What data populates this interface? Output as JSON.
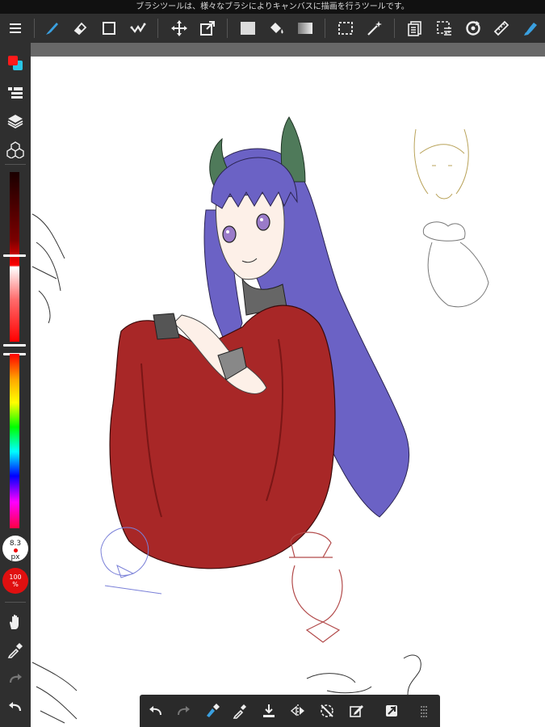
{
  "status_bar": {
    "hint": "ブラシツールは、様々なブラシによりキャンバスに描画を行うツールです。"
  },
  "toolbar": {
    "tools": [
      {
        "name": "menu-icon"
      },
      {
        "name": "brush-icon",
        "active": true
      },
      {
        "name": "eraser-icon"
      },
      {
        "name": "shape-icon"
      },
      {
        "name": "select-pen-icon"
      },
      {
        "name": "move-icon"
      },
      {
        "name": "transform-icon"
      },
      {
        "name": "fill-color-icon"
      },
      {
        "name": "bucket-icon"
      },
      {
        "name": "gradient-icon"
      },
      {
        "name": "select-rect-icon"
      },
      {
        "name": "magic-wand-icon"
      },
      {
        "name": "layer-list-icon"
      },
      {
        "name": "select-layer-icon"
      },
      {
        "name": "rotate-icon"
      },
      {
        "name": "ruler-icon"
      },
      {
        "name": "brush-cursor-icon"
      }
    ]
  },
  "sidebar": {
    "size_label": "8.3",
    "size_unit": "px",
    "opacity_label": "100",
    "opacity_unit": "%",
    "primary_color": "#ff1a1a",
    "secondary_color": "#29c6e6"
  },
  "bottom_toolbar": {
    "tools": [
      {
        "name": "undo-icon"
      },
      {
        "name": "redo-icon"
      },
      {
        "name": "brush-eraser-toggle-icon"
      },
      {
        "name": "eyedropper-icon"
      },
      {
        "name": "save-icon"
      },
      {
        "name": "flip-icon"
      },
      {
        "name": "snap-off-icon"
      },
      {
        "name": "edit-icon"
      },
      {
        "name": "canvas-toggle-icon"
      },
      {
        "name": "grip-icon"
      }
    ]
  },
  "colors": {
    "accent": "#3aa0e0",
    "toolbar_bg": "#2f2f2f",
    "canvas_bg": "#ffffff"
  }
}
